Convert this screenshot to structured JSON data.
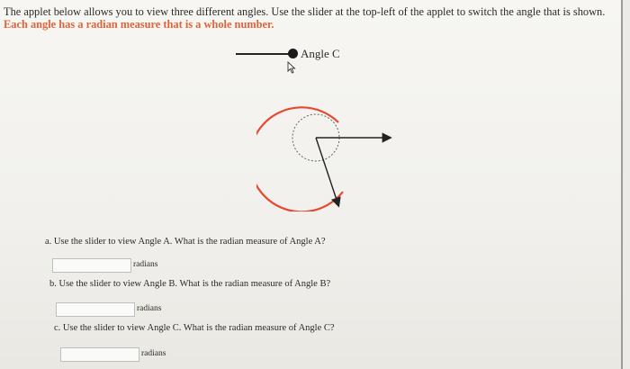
{
  "intro": {
    "text": "The applet below allows you to view three different angles. Use the slider at the top-left of the applet to switch the angle that is shown. ",
    "highlight": "Each angle has a radian measure that is a whole number."
  },
  "slider": {
    "label": "Angle C"
  },
  "questions": [
    {
      "text": "a. Use the slider to view Angle A. What is the radian measure of Angle A?",
      "value": "",
      "unit": "radians"
    },
    {
      "text": "b. Use the slider to view Angle B. What is the radian measure of Angle B?",
      "value": "",
      "unit": "radians"
    },
    {
      "text": "c. Use the slider to view Angle C. What is the radian measure of Angle C?",
      "value": "",
      "unit": "radians"
    }
  ],
  "colors": {
    "highlight": "#e0633a",
    "arc": "#e8482f",
    "dashed_circle": "#555555"
  },
  "icons": [
    "cursor-arrow-icon",
    "slider-knob"
  ]
}
